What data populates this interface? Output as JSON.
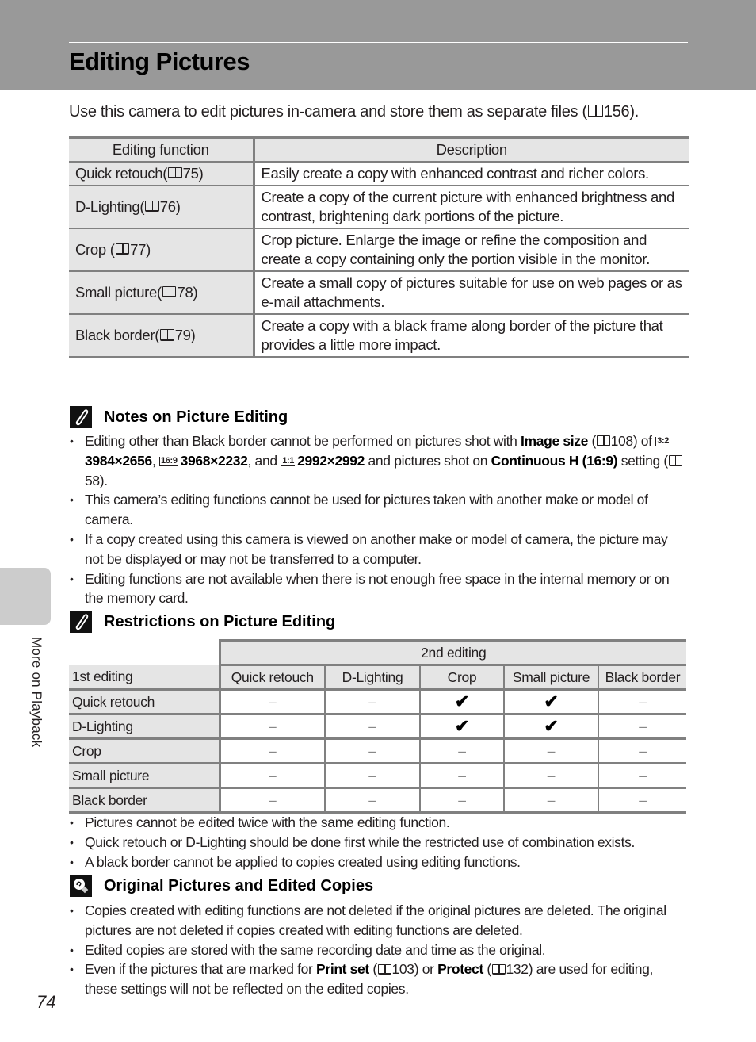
{
  "header": {
    "title": "Editing Pictures"
  },
  "intro": {
    "text_before": "Use this camera to edit pictures in-camera and store them as separate files (",
    "ref": "156",
    "text_after": ")."
  },
  "functions_table": {
    "columns": [
      "Editing function",
      "Description"
    ],
    "rows": [
      {
        "function": "Quick retouch(",
        "ref": "75",
        "suffix": ")",
        "description": "Easily create a copy with enhanced contrast and richer colors."
      },
      {
        "function": "D-Lighting(",
        "ref": "76",
        "suffix": ")",
        "description": "Create a copy of the current picture with enhanced brightness and contrast, brightening dark portions of the picture."
      },
      {
        "function": "Crop (",
        "ref": "77",
        "suffix": ")",
        "description": "Crop picture. Enlarge the image or refine the composition and create a copy containing only the portion visible in the monitor."
      },
      {
        "function": "Small picture(",
        "ref": "78",
        "suffix": ")",
        "description": "Create a small copy of pictures suitable for use on web pages or as e-mail attachments."
      },
      {
        "function": "Black border(",
        "ref": "79",
        "suffix": ")",
        "description": "Create a copy with a black frame along border of the picture that provides a little more impact."
      }
    ]
  },
  "notes": {
    "heading": "Notes on Picture Editing",
    "icon": "pencil-note-icon",
    "bullet1": {
      "t1": "Editing other than Black border cannot be performed on pictures shot with ",
      "b1": "Image size",
      "t2": " (",
      "r1": "108",
      "t3": ") of ",
      "icon1": "3:2",
      "b2": "3984×2656",
      "t4": ", ",
      "icon2": "16:9",
      "b3": "3968×2232",
      "t5": ", and ",
      "icon3": "1:1",
      "b4": "2992×2992",
      "t6": " and pictures shot on ",
      "b5": "Continuous H (16:9)",
      "t7": " setting (",
      "r2": "58",
      "t8": ")."
    },
    "bullets": [
      "This camera’s editing functions cannot be used for pictures taken with another make or model of camera.",
      "If a copy created using this camera is viewed on another make or model of camera, the picture may not be displayed or may not be transferred to a computer.",
      "Editing functions are not available when there is not enough free space in the internal memory or on the memory card."
    ]
  },
  "restrictions": {
    "heading": "Restrictions on Picture Editing",
    "icon": "pencil-note-icon",
    "second_label": "2nd editing",
    "first_label": "1st editing",
    "columns": [
      "Quick retouch",
      "D-Lighting",
      "Crop",
      "Small picture",
      "Black border"
    ],
    "rows": [
      {
        "label": "Quick retouch",
        "cells": [
          "–",
          "–",
          "✔",
          "✔",
          "–"
        ]
      },
      {
        "label": "D-Lighting",
        "cells": [
          "–",
          "–",
          "✔",
          "✔",
          "–"
        ]
      },
      {
        "label": "Crop",
        "cells": [
          "–",
          "–",
          "–",
          "–",
          "–"
        ]
      },
      {
        "label": "Small picture",
        "cells": [
          "–",
          "–",
          "–",
          "–",
          "–"
        ]
      },
      {
        "label": "Black border",
        "cells": [
          "–",
          "–",
          "–",
          "–",
          "–"
        ]
      }
    ],
    "bullets": [
      "Pictures cannot be edited twice with the same editing function.",
      "Quick retouch or D-Lighting should be done first while the restricted use of combination exists.",
      "A black border cannot be applied to copies created using editing functions."
    ]
  },
  "original": {
    "heading": "Original Pictures and Edited Copies",
    "icon": "lightbulb-tip-icon",
    "bullets": [
      "Copies created with editing functions are not deleted if the original pictures are deleted. The original pictures are not deleted if copies created with editing functions are deleted.",
      "Edited copies are stored with the same recording date and time as the original."
    ],
    "bullet3": {
      "t1": "Even if the pictures that are marked for ",
      "b1": "Print set",
      "t2": " (",
      "r1": "103",
      "t3": ") or ",
      "b2": "Protect",
      "t4": " (",
      "r2": "132",
      "t5": ") are used for editing, these settings will not be reflected on the edited copies."
    }
  },
  "sidebar": {
    "section_label": "More on Playback"
  },
  "footer": {
    "page_number": "74"
  }
}
